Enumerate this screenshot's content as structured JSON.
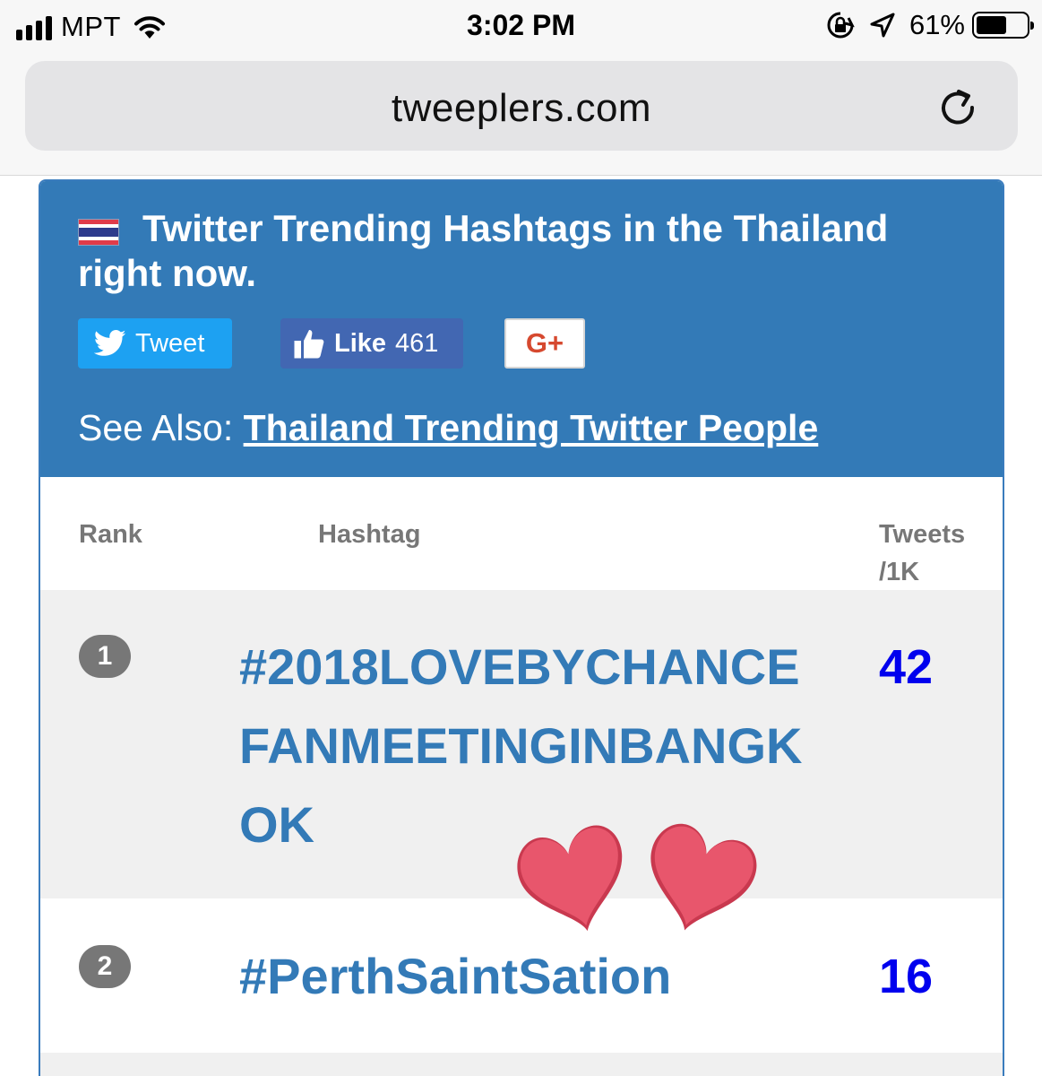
{
  "status_bar": {
    "carrier": "MPT",
    "time": "3:02 PM",
    "battery_percent": "61%",
    "battery_level": 0.61,
    "icons": [
      "signal-icon",
      "wifi-icon",
      "orientation-lock-icon",
      "location-arrow-icon",
      "battery-icon"
    ]
  },
  "browser": {
    "url": "tweeplers.com",
    "reload_icon": "reload-icon"
  },
  "header": {
    "title": "Twitter Trending Hashtags in the Thailand right now.",
    "flag_icon": "thailand-flag-icon",
    "colors": {
      "background": "#337ab7",
      "text": "#ffffff"
    }
  },
  "share": {
    "tweet_label": "Tweet",
    "like_label": "Like",
    "like_count": "461",
    "gplus_label": "G+"
  },
  "see_also": {
    "label": "See Also: ",
    "link_text": "Thailand Trending Twitter People"
  },
  "table": {
    "columns": [
      "Rank",
      "Hashtag",
      "Tweets /1K"
    ],
    "rows": [
      {
        "rank": "1",
        "hashtag": "#2018LOVEBYCHANCEFANMEETINGINBANGKOK",
        "tweets": "42"
      },
      {
        "rank": "2",
        "hashtag": "#PerthSaintSation",
        "tweets": "16"
      }
    ],
    "colors": {
      "hashtag": "#337ab7",
      "count": "#0000ee",
      "rank_badge": "#777777"
    }
  },
  "overlay": {
    "stickers": [
      "heart-icon",
      "heart-icon"
    ],
    "color": "#e8566c"
  }
}
